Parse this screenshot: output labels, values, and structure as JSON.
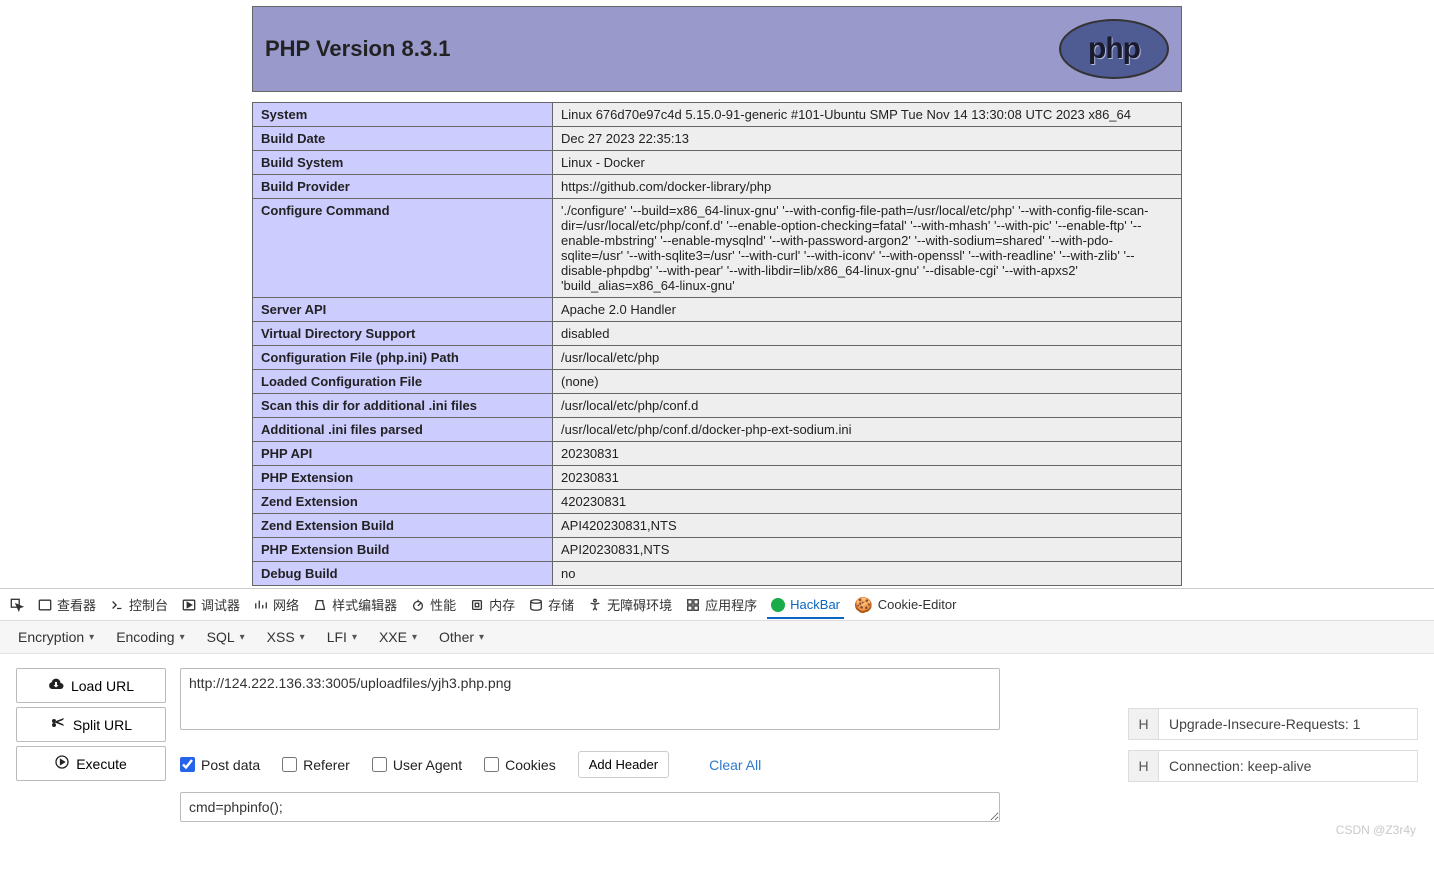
{
  "phpinfo": {
    "title": "PHP Version 8.3.1",
    "logo_text": "php",
    "rows": [
      {
        "label": "System",
        "value": "Linux 676d70e97c4d 5.15.0-91-generic #101-Ubuntu SMP Tue Nov 14 13:30:08 UTC 2023 x86_64"
      },
      {
        "label": "Build Date",
        "value": "Dec 27 2023 22:35:13"
      },
      {
        "label": "Build System",
        "value": "Linux - Docker"
      },
      {
        "label": "Build Provider",
        "value": "https://github.com/docker-library/php"
      },
      {
        "label": "Configure Command",
        "value": "'./configure' '--build=x86_64-linux-gnu' '--with-config-file-path=/usr/local/etc/php' '--with-config-file-scan-dir=/usr/local/etc/php/conf.d' '--enable-option-checking=fatal' '--with-mhash' '--with-pic' '--enable-ftp' '--enable-mbstring' '--enable-mysqlnd' '--with-password-argon2' '--with-sodium=shared' '--with-pdo-sqlite=/usr' '--with-sqlite3=/usr' '--with-curl' '--with-iconv' '--with-openssl' '--with-readline' '--with-zlib' '--disable-phpdbg' '--with-pear' '--with-libdir=lib/x86_64-linux-gnu' '--disable-cgi' '--with-apxs2' 'build_alias=x86_64-linux-gnu'"
      },
      {
        "label": "Server API",
        "value": "Apache 2.0 Handler"
      },
      {
        "label": "Virtual Directory Support",
        "value": "disabled"
      },
      {
        "label": "Configuration File (php.ini) Path",
        "value": "/usr/local/etc/php"
      },
      {
        "label": "Loaded Configuration File",
        "value": "(none)"
      },
      {
        "label": "Scan this dir for additional .ini files",
        "value": "/usr/local/etc/php/conf.d"
      },
      {
        "label": "Additional .ini files parsed",
        "value": "/usr/local/etc/php/conf.d/docker-php-ext-sodium.ini"
      },
      {
        "label": "PHP API",
        "value": "20230831"
      },
      {
        "label": "PHP Extension",
        "value": "20230831"
      },
      {
        "label": "Zend Extension",
        "value": "420230831"
      },
      {
        "label": "Zend Extension Build",
        "value": "API420230831,NTS"
      },
      {
        "label": "PHP Extension Build",
        "value": "API20230831,NTS"
      },
      {
        "label": "Debug Build",
        "value": "no"
      }
    ]
  },
  "devtools": {
    "tabs": {
      "inspector": "查看器",
      "console": "控制台",
      "debugger": "调试器",
      "network": "网络",
      "style": "样式编辑器",
      "performance": "性能",
      "memory": "内存",
      "storage": "存储",
      "accessibility": "无障碍环境",
      "application": "应用程序",
      "hackbar": "HackBar",
      "cookie": "Cookie-Editor"
    }
  },
  "hackbar": {
    "dropdowns": {
      "encryption": "Encryption",
      "encoding": "Encoding",
      "sql": "SQL",
      "xss": "XSS",
      "lfi": "LFI",
      "xxe": "XXE",
      "other": "Other"
    },
    "buttons": {
      "load": "Load URL",
      "split": "Split URL",
      "execute": "Execute"
    },
    "url_value": "http://124.222.136.33:3005/uploadfiles/yjh3.php.png",
    "options": {
      "post": "Post data",
      "referer": "Referer",
      "user_agent": "User Agent",
      "cookies": "Cookies",
      "add_header": "Add Header",
      "clear_all": "Clear All"
    },
    "body_value": "cmd=phpinfo();",
    "headers": [
      {
        "k": "H",
        "t": "Upgrade-Insecure-Requests: 1"
      },
      {
        "k": "H",
        "t": "Connection: keep-alive"
      }
    ]
  },
  "watermark": "CSDN @Z3r4y"
}
